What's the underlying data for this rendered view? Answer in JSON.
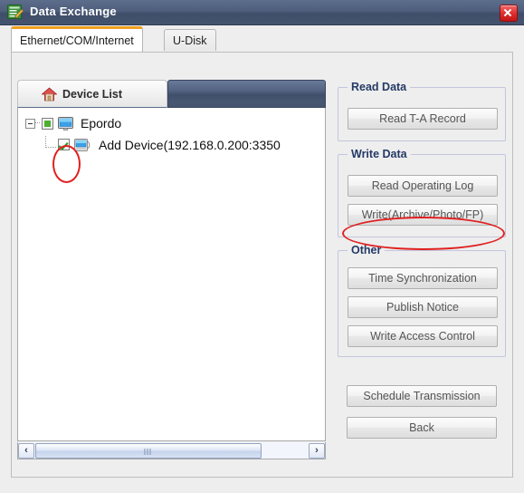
{
  "window": {
    "title": "Data Exchange",
    "icon": "document-edit-icon",
    "close_label": "✕"
  },
  "tabs": [
    {
      "id": "ethernet",
      "label": "Ethernet/COM/Internet",
      "active": true
    },
    {
      "id": "udisk",
      "label": "U-Disk",
      "active": false
    }
  ],
  "device_panel": {
    "tab_label": "Device List",
    "tab_icon": "home-icon",
    "tree": {
      "root": {
        "label": "Epordo",
        "icon": "monitor-icon",
        "expander": "minus-box-icon",
        "checkbox_state": "partial"
      },
      "children": [
        {
          "label": "Add Device(192.168.0.200:3350",
          "icon": "device-icon",
          "checkbox_state": "checked"
        }
      ]
    },
    "scrollbar": {
      "left_arrow": "‹",
      "right_arrow": "›",
      "orientation": "horizontal"
    }
  },
  "groups": [
    {
      "id": "read",
      "title": "Read Data",
      "buttons": [
        {
          "id": "read-ta-record",
          "label": "Read T-A Record"
        }
      ]
    },
    {
      "id": "write",
      "title": "Write Data",
      "buttons": [
        {
          "id": "read-operating-log",
          "label": "Read Operating Log"
        },
        {
          "id": "write-archive-photo-fp",
          "label": "Write(Archive/Photo/FP)"
        }
      ]
    },
    {
      "id": "other",
      "title": "Other",
      "buttons": [
        {
          "id": "time-synchronization",
          "label": "Time Synchronization"
        },
        {
          "id": "publish-notice",
          "label": "Publish Notice"
        },
        {
          "id": "write-access-control",
          "label": "Write Access Control"
        }
      ]
    }
  ],
  "footer_buttons": [
    {
      "id": "schedule-transmission",
      "label": "Schedule Transmission"
    },
    {
      "id": "back",
      "label": "Back"
    }
  ],
  "annotations": {
    "color": "#e02020",
    "items": [
      {
        "id": "checkbox-highlight",
        "shape": "ellipse"
      },
      {
        "id": "write-button-highlight",
        "shape": "ellipse"
      }
    ]
  }
}
